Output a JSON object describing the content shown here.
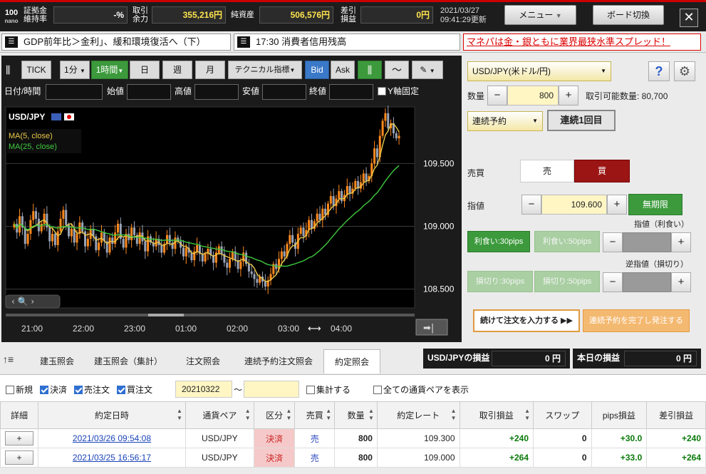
{
  "topbar": {
    "logo_main": "100",
    "logo_sub": "nano",
    "margin_label_1": "証拠金",
    "margin_label_2": "維持率",
    "margin_value": "-%",
    "margin_avail_label_1": "取引",
    "margin_avail_label_2": "余力",
    "margin_avail_value": "355,216円",
    "equity_label": "純資産",
    "equity_value": "506,576円",
    "pl_label_1": "差引",
    "pl_label_2": "損益",
    "pl_value": "0円",
    "date": "2021/03/27",
    "time": "09:41:29更新",
    "menu_label": "メニュー",
    "board_label": "ボード切換",
    "close_label": "✕"
  },
  "news": {
    "item1": "GDP前年比＞金利」、緩和環境復活へ（下）",
    "item2": "17:30 消費者信用残高",
    "promo": "マネパは金・銀ともに業界最狭水準スプレッド！"
  },
  "chart_toolbar": {
    "tick": "TICK",
    "interval1": "1分",
    "interval2": "1時間",
    "day": "日",
    "week": "週",
    "month": "月",
    "technical": "テクニカル指標",
    "bid": "Bid",
    "ask": "Ask"
  },
  "ohlc": {
    "datetime": "日付/時間",
    "open": "始値",
    "high": "高値",
    "low": "安値",
    "close": "終値",
    "yfix": "Y軸固定"
  },
  "chart_labels": {
    "pair": "USD/JPY",
    "ma5": "MA(5, close)",
    "ma25": "MA(25, close)",
    "price_ticks": [
      "109.500",
      "109.000",
      "108.500"
    ],
    "time_ticks": [
      "21:00",
      "22:00",
      "23:00",
      "01:00",
      "02:00",
      "03:00",
      "04:00"
    ]
  },
  "chart_data": {
    "type": "candlestick",
    "ylim": [
      108.35,
      109.95
    ],
    "yticks": [
      109.5,
      109.0,
      108.5
    ],
    "xticks": [
      "21:00",
      "22:00",
      "23:00",
      "01:00",
      "02:00",
      "03:00",
      "04:00"
    ],
    "series": [
      {
        "name": "MA(5, close)",
        "color": "#e8c84a"
      },
      {
        "name": "MA(25, close)",
        "color": "#3ec93e"
      }
    ],
    "close": [
      109.02,
      108.95,
      109.08,
      108.99,
      108.86,
      108.94,
      109.05,
      109.12,
      109.06,
      108.96,
      109.02,
      109.1,
      108.99,
      108.88,
      108.94,
      108.85,
      108.96,
      109.06,
      109.13,
      109.01,
      108.92,
      108.98,
      108.87,
      108.94,
      109.03,
      108.96,
      108.84,
      108.9,
      108.98,
      108.92,
      108.81,
      108.87,
      108.95,
      108.88,
      108.79,
      108.91,
      108.86,
      108.95,
      109.02,
      108.9,
      108.83,
      108.94,
      108.89,
      108.99,
      108.93,
      108.86,
      108.95,
      108.88,
      108.8,
      108.92,
      108.87,
      108.84,
      108.9,
      108.85,
      108.79,
      108.86,
      108.93,
      108.87,
      108.82,
      108.91,
      108.88,
      108.83,
      108.76,
      108.83,
      108.79,
      108.73,
      108.8,
      108.85,
      108.78,
      108.72,
      108.78,
      108.82,
      108.77,
      108.71,
      108.79,
      108.84,
      108.78,
      108.71,
      108.67,
      108.74,
      108.8,
      108.73,
      108.66,
      108.72,
      108.79,
      108.7,
      108.64,
      108.62,
      108.58,
      108.55,
      108.6,
      108.56,
      108.52,
      108.57,
      108.62,
      108.7,
      108.66,
      108.74,
      108.8,
      108.76,
      108.86,
      108.93,
      108.87,
      108.82,
      108.94,
      108.99,
      108.92,
      108.97,
      109.05,
      108.98,
      109.04,
      109.1,
      109.05,
      109.14,
      109.09,
      109.18,
      109.24,
      109.16,
      109.22,
      109.28,
      109.2,
      109.25,
      109.32,
      109.26,
      109.3,
      109.36,
      109.3,
      109.35,
      109.42,
      109.36,
      109.4,
      109.5,
      109.62,
      109.55,
      109.72,
      109.84,
      109.9,
      109.78,
      109.82,
      109.74,
      109.7,
      109.72
    ]
  },
  "order": {
    "pair": "USD/JPY(米ドル/円)",
    "help": "?",
    "qty_label": "数量",
    "qty": "800",
    "avail_label": "取引可能数量: 80,700",
    "order_type": "連続予約",
    "sequence": "連続1回目",
    "side_label": "売買",
    "sell": "売",
    "buy": "買",
    "limit_label": "指値",
    "limit_price": "109.600",
    "expiry": "無期限",
    "tp_label": "指値（利食い）",
    "tp30": "利食い:30pips",
    "tp50": "利食い:50pips",
    "sl_label": "逆指値（損切り）",
    "sl30": "損切り:30pips",
    "sl50": "損切り:50pips",
    "continue": "続けて注文を入力する ▶▶",
    "complete": "連続予約を完了し発注する",
    "minus": "−",
    "plus": "+"
  },
  "tabs": {
    "items": [
      "建玉照会",
      "建玉照会（集計）",
      "注文照会",
      "連続予約注文照会",
      "約定照会"
    ],
    "active": 4
  },
  "pl": {
    "pair_label": "USD/JPYの損益",
    "pair_value": "0 円",
    "today_label": "本日の損益",
    "today_value": "0 円"
  },
  "filters": {
    "new": "新規",
    "settle": "決済",
    "sell": "売注文",
    "buy": "買注文",
    "from": "20210322",
    "tilde": "〜",
    "to": "",
    "aggregate": "集計する",
    "all_pairs": "全ての通貨ペアを表示"
  },
  "table": {
    "headers": [
      "詳細",
      "約定日時",
      "通貨ペア",
      "区分",
      "売買",
      "数量",
      "約定レート",
      "取引損益",
      "スワップ",
      "pips損益",
      "差引損益"
    ],
    "rows": [
      {
        "btn": "+",
        "datetime": "2021/03/26 09:54:08",
        "pair": "USD/JPY",
        "kind": "決済",
        "side": "売",
        "qty": "800",
        "rate": "109.300",
        "pl": "+240",
        "swap": "0",
        "pips": "+30.0",
        "net": "+240"
      },
      {
        "btn": "+",
        "datetime": "2021/03/25 16:56:17",
        "pair": "USD/JPY",
        "kind": "決済",
        "side": "売",
        "qty": "800",
        "rate": "109.000",
        "pl": "+264",
        "swap": "0",
        "pips": "+33.0",
        "net": "+264"
      }
    ]
  },
  "colors": {
    "accent_green": "#3c9a3c",
    "buy_red": "#9b1515",
    "brand_red": "#c00000"
  }
}
